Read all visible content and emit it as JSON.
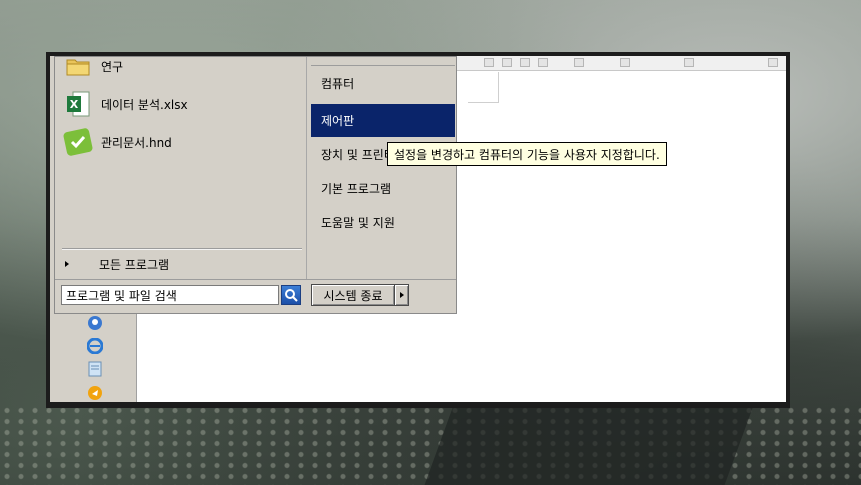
{
  "left_programs": [
    {
      "label": "연구",
      "icon": "folder-icon"
    },
    {
      "label": "데이터 분석.xlsx",
      "icon": "excel-file-icon"
    },
    {
      "label": "관리문서.hnd",
      "icon": "hangul-document-icon"
    }
  ],
  "all_programs_label": "모든 프로그램",
  "right_items": [
    {
      "label": "컴퓨터"
    },
    {
      "label": "제어판"
    },
    {
      "label": "장치 및 프린터"
    },
    {
      "label": "기본 프로그램"
    },
    {
      "label": "도움말 및 지원"
    }
  ],
  "search": {
    "value": "프로그램 및 파일 검색"
  },
  "shutdown_label": "시스템 종료",
  "tooltip_text": "설정을 변경하고 컴퓨터의 기능을 사용자 지정합니다.",
  "colors": {
    "selected_bg": "#0a246a",
    "menu_bg": "#d4d0c8",
    "tooltip_bg": "#ffffe1"
  }
}
